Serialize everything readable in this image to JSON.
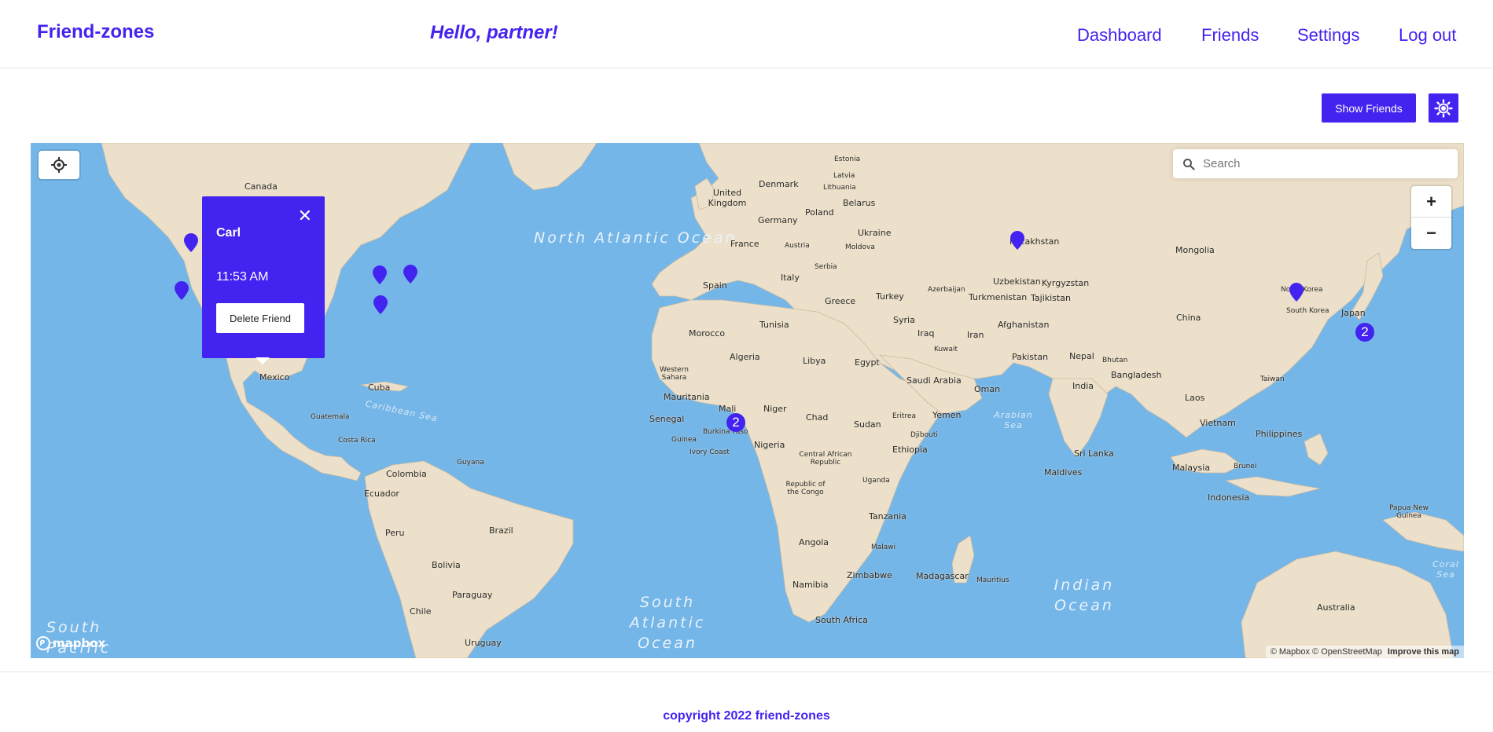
{
  "header": {
    "brand": "Friend-zones",
    "greeting": "Hello, partner!",
    "nav": {
      "dashboard": "Dashboard",
      "friends": "Friends",
      "settings": "Settings",
      "logout": "Log out"
    }
  },
  "controls": {
    "show_friends_label": "Show Friends",
    "theme_icon": "sun-icon"
  },
  "map": {
    "search_placeholder": "Search",
    "zoom_in": "+",
    "zoom_out": "−",
    "oceans": {
      "north_atlantic": "North Atlantic Ocean",
      "south_atlantic": "South Atlantic Ocean",
      "indian": "Indian Ocean",
      "south_pacific": "South Pacific"
    },
    "seas": {
      "caribbean": "Caribbean Sea",
      "arabian": "Arabian Sea",
      "coral": "Coral Sea"
    },
    "places": [
      "Canada",
      "Mexico",
      "Cuba",
      "Guatemala",
      "Costa Rica",
      "Colombia",
      "Guyana",
      "Ecuador",
      "Peru",
      "Brazil",
      "Bolivia",
      "Paraguay",
      "Chile",
      "Uruguay",
      "Estonia",
      "Latvia",
      "Lithuania",
      "Denmark",
      "United Kingdom",
      "Belarus",
      "Poland",
      "Germany",
      "Ukraine",
      "France",
      "Austria",
      "Moldova",
      "Serbia",
      "Spain",
      "Italy",
      "Greece",
      "Turkey",
      "Azerbaijan",
      "Morocco",
      "Tunisia",
      "Syria",
      "Iraq",
      "Iran",
      "Kuwait",
      "Algeria",
      "Libya",
      "Egypt",
      "Western Sahara",
      "Saudi Arabia",
      "Oman",
      "Mauritania",
      "Mali",
      "Niger",
      "Chad",
      "Sudan",
      "Eritrea",
      "Yemen",
      "Senegal",
      "Burkina Faso",
      "Guinea",
      "Nigeria",
      "Djibouti",
      "Ivory Coast",
      "Ethiopia",
      "Central African Republic",
      "Republic of the Congo",
      "Uganda",
      "Tanzania",
      "Angola",
      "Malawi",
      "Zimbabwe",
      "Namibia",
      "Madagascar",
      "Mauritius",
      "South Africa",
      "Kazakhstan",
      "Mongolia",
      "Uzbekistan",
      "Kyrgyzstan",
      "Turkmenistan",
      "Tajikistan",
      "Afghanistan",
      "Pakistan",
      "Nepal",
      "Bhutan",
      "India",
      "Bangladesh",
      "China",
      "North Korea",
      "South Korea",
      "Japan",
      "Taiwan",
      "Laos",
      "Vietnam",
      "Philippines",
      "Sri Lanka",
      "Maldives",
      "Malaysia",
      "Brunei",
      "Indonesia",
      "Papua New Guinea",
      "Australia"
    ],
    "clusters": [
      "2",
      "2"
    ],
    "popup": {
      "name": "Carl",
      "time": "11:53 AM",
      "delete_label": "Delete Friend",
      "close": "✕"
    },
    "logo_text": "mapbox",
    "attribution": "© Mapbox © OpenStreetMap",
    "improve": "Improve this map"
  },
  "footer": {
    "copyright": "copyright 2022 friend-zones"
  },
  "colors": {
    "brand": "#4323f0",
    "ocean": "#75b6e8",
    "land": "#ece0ca"
  }
}
